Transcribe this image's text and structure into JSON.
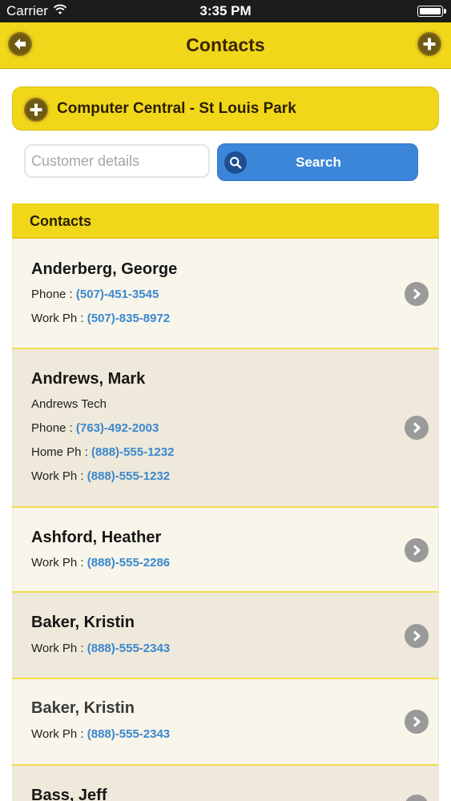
{
  "status_bar": {
    "carrier": "Carrier",
    "time": "3:35 PM"
  },
  "nav": {
    "title": "Contacts",
    "back_icon": "arrow-left-icon",
    "add_icon": "plus-icon"
  },
  "company": {
    "name": "Computer Central - St Louis Park",
    "add_icon": "plus-icon"
  },
  "search": {
    "placeholder": "Customer details",
    "value": "",
    "button_label": "Search",
    "icon": "search-icon"
  },
  "contacts_header": "Contacts",
  "contacts": [
    {
      "name": "Anderberg, George",
      "company": "",
      "lines": [
        {
          "label": "Phone : ",
          "number": "(507)-451-3545"
        },
        {
          "label": "Work Ph : ",
          "number": "(507)-835-8972"
        }
      ]
    },
    {
      "name": "Andrews, Mark",
      "company": "Andrews Tech",
      "lines": [
        {
          "label": "Phone : ",
          "number": "(763)-492-2003"
        },
        {
          "label": "Home Ph : ",
          "number": "(888)-555-1232"
        },
        {
          "label": "Work Ph : ",
          "number": "(888)-555-1232"
        }
      ]
    },
    {
      "name": "Ashford, Heather",
      "company": "",
      "lines": [
        {
          "label": "Work Ph : ",
          "number": "(888)-555-2286"
        }
      ]
    },
    {
      "name": "Baker, Kristin",
      "company": "",
      "lines": [
        {
          "label": "Work Ph : ",
          "number": "(888)-555-2343"
        }
      ]
    },
    {
      "name": "Baker, Kristin",
      "company": "",
      "lines": [
        {
          "label": "Work Ph : ",
          "number": "(888)-555-2343"
        }
      ]
    },
    {
      "name": "Bass, Jeff",
      "company": "",
      "lines": []
    }
  ],
  "colors": {
    "accent_yellow": "#f0d71a",
    "link_blue": "#3a87cf",
    "button_blue": "#3c86d9"
  }
}
